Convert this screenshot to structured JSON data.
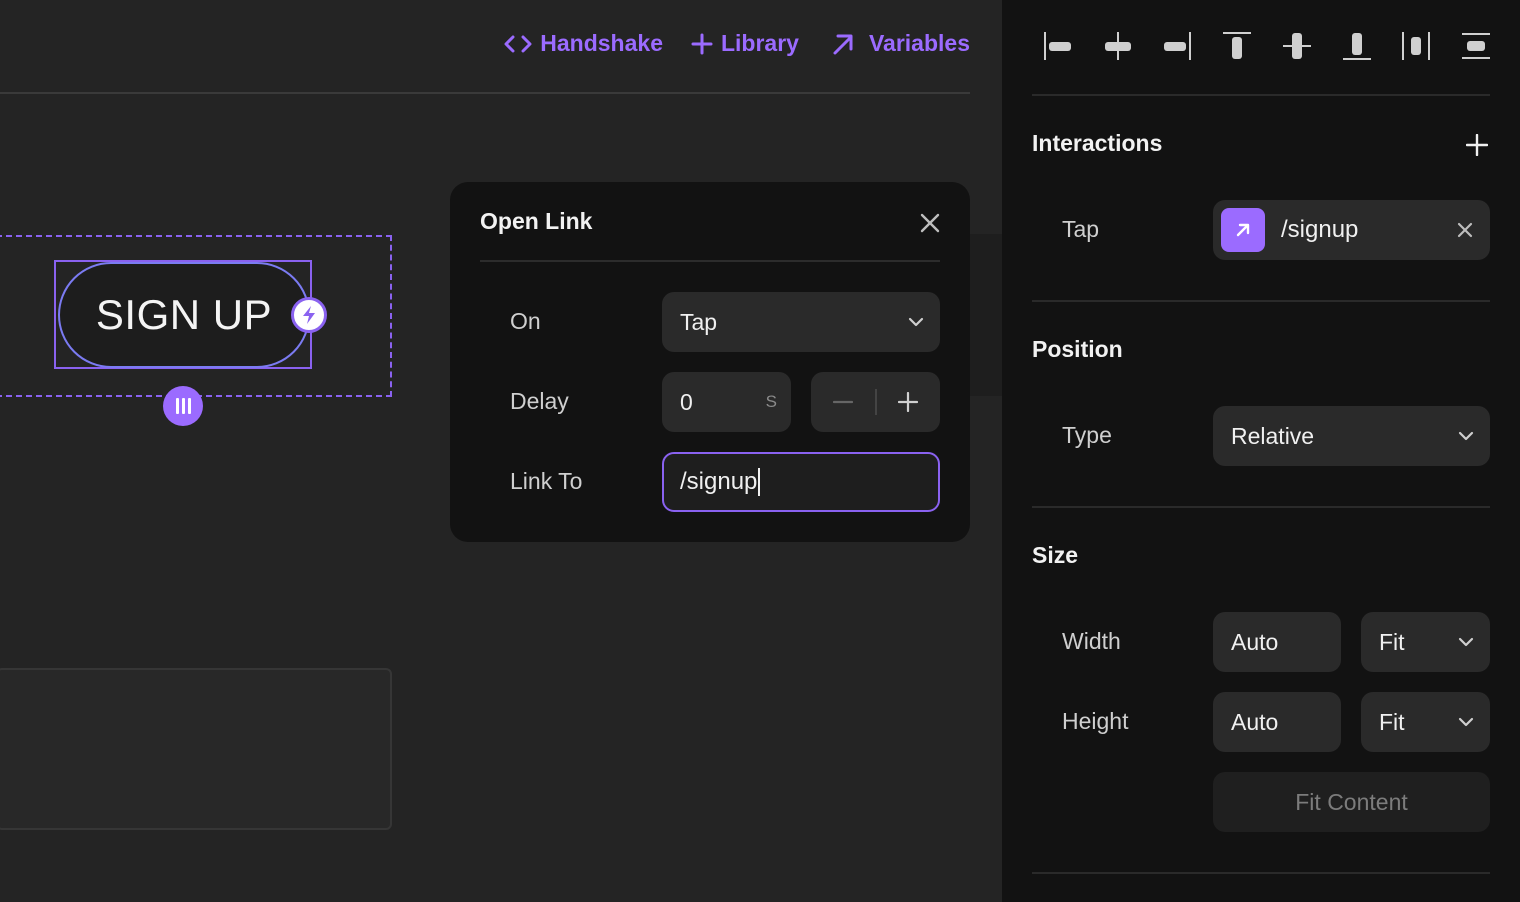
{
  "toolbar": {
    "handshake_label": "Handshake",
    "library_label": "Library",
    "variables_label": "Variables"
  },
  "canvas": {
    "signup_button_label": "SIGN UP"
  },
  "popover": {
    "title": "Open Link",
    "on_label": "On",
    "on_value": "Tap",
    "delay_label": "Delay",
    "delay_value": "0",
    "delay_unit": "S",
    "link_label": "Link To",
    "link_value": "/signup"
  },
  "panel": {
    "interactions": {
      "title": "Interactions",
      "trigger_label": "Tap",
      "action_value": "/signup"
    },
    "position": {
      "title": "Position",
      "type_label": "Type",
      "type_value": "Relative"
    },
    "size": {
      "title": "Size",
      "width_label": "Width",
      "width_value": "Auto",
      "width_mode": "Fit",
      "height_label": "Height",
      "height_value": "Auto",
      "height_mode": "Fit",
      "fit_content_label": "Fit Content"
    }
  },
  "colors": {
    "accent": "#9b6bff",
    "panel_bg": "#121212",
    "canvas_bg": "#242424"
  }
}
